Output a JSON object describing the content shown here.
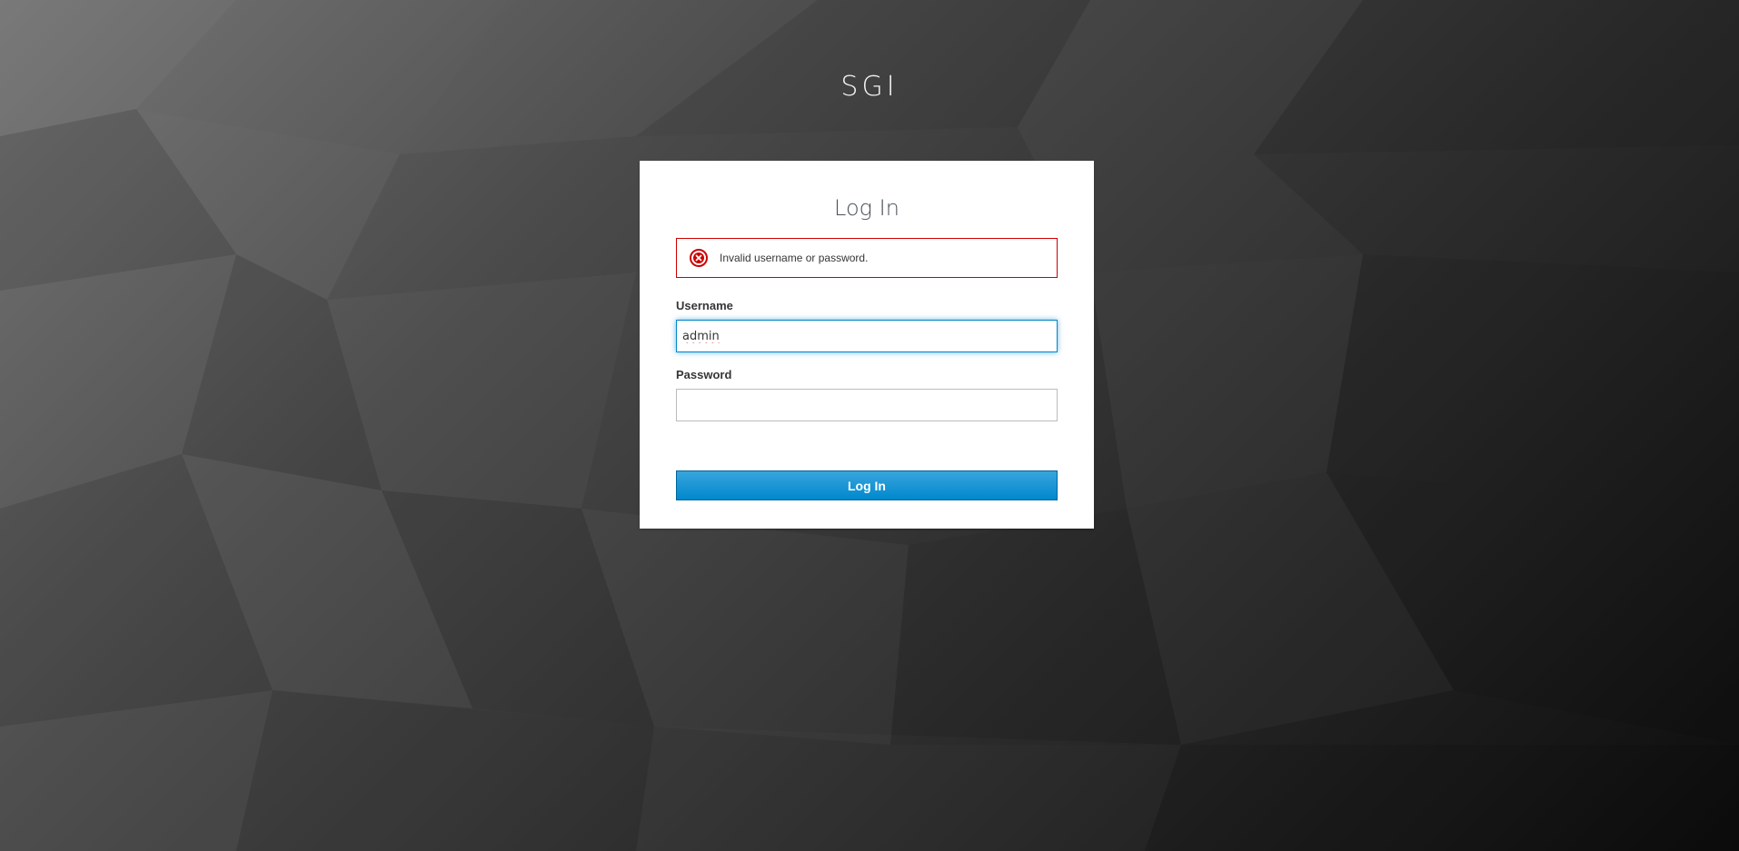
{
  "realm": {
    "title": "SGI"
  },
  "form": {
    "title": "Log In",
    "error": {
      "icon": "error-circle-icon",
      "message": "Invalid username or password.",
      "color": "#cc0000"
    },
    "username": {
      "label": "Username",
      "value": "admin"
    },
    "password": {
      "label": "Password",
      "value": ""
    },
    "submit_label": "Log In"
  },
  "colors": {
    "accent": "#0088ce",
    "error": "#cc0000"
  }
}
